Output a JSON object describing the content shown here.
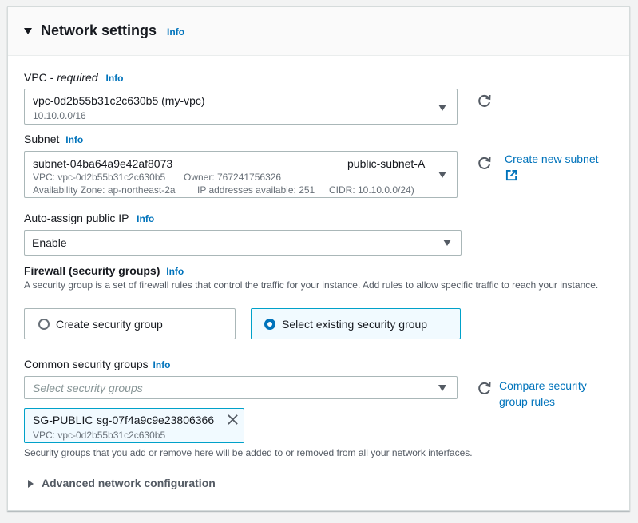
{
  "section": {
    "title": "Network settings",
    "info": "Info"
  },
  "vpc": {
    "label": "VPC - ",
    "required": "required",
    "info": "Info",
    "value": "vpc-0d2b55b31c2c630b5 (my-vpc)",
    "cidr": "10.10.0.0/16"
  },
  "subnet": {
    "label": "Subnet",
    "info": "Info",
    "id": "subnet-04ba64a9e42af8073",
    "name": "public-subnet-A",
    "vpc": "VPC: vpc-0d2b55b31c2c630b5",
    "owner": "Owner: 767241756326",
    "az": "Availability Zone: ap-northeast-2a",
    "ips": "IP addresses available: 251",
    "cidr": "CIDR: 10.10.0.0/24)",
    "create_link": "Create new subnet"
  },
  "public_ip": {
    "label": "Auto-assign public IP",
    "info": "Info",
    "value": "Enable"
  },
  "firewall": {
    "label": "Firewall (security groups)",
    "info": "Info",
    "description": "A security group is a set of firewall rules that control the traffic for your instance. Add rules to allow specific traffic to reach your instance.",
    "option_create": "Create security group",
    "option_existing": "Select existing security group",
    "selected": "existing"
  },
  "common_sg": {
    "label": "Common security groups",
    "info": "Info",
    "placeholder": "Select security groups",
    "compare_link_line1": "Compare security",
    "compare_link_line2": "group rules",
    "token_name": "SG-PUBLIC",
    "token_id": "sg-07f4a9c9e23806366",
    "token_vpc": "VPC: vpc-0d2b55b31c2c630b5",
    "note": "Security groups that you add or remove here will be added to or removed from all your network interfaces."
  },
  "advanced": {
    "label": "Advanced network configuration"
  },
  "colors": {
    "link": "#0073bb",
    "selected_border": "#00a1c9",
    "selected_bg": "#f1faff"
  }
}
